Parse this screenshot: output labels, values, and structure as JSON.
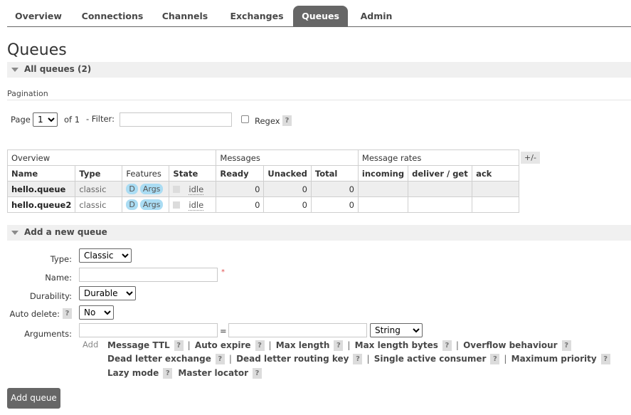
{
  "nav": {
    "tabs": [
      {
        "label": "Overview"
      },
      {
        "label": "Connections"
      },
      {
        "label": "Channels"
      },
      {
        "label": "Exchanges"
      },
      {
        "label": "Queues",
        "active": true
      },
      {
        "label": "Admin"
      }
    ]
  },
  "page": {
    "title": "Queues",
    "all_queues_label": "All queues (2)",
    "pagination_label": "Pagination"
  },
  "pager": {
    "page_label": "Page",
    "page_value": "1",
    "of_label": "of 1",
    "filter_label": "- Filter:",
    "filter_value": "",
    "regex_label": "Regex",
    "help": "?"
  },
  "table": {
    "group_headers": [
      "Overview",
      "Messages",
      "Message rates"
    ],
    "plus_minus": "+/-",
    "columns": [
      "Name",
      "Type",
      "Features",
      "State",
      "Ready",
      "Unacked",
      "Total",
      "incoming",
      "deliver / get",
      "ack"
    ],
    "rows": [
      {
        "name": "hello.queue",
        "type": "classic",
        "feature_d": "D",
        "feature_args": "Args",
        "state": "idle",
        "ready": "0",
        "unacked": "0",
        "total": "0",
        "incoming": "",
        "deliver_get": "",
        "ack": ""
      },
      {
        "name": "hello.queue2",
        "type": "classic",
        "feature_d": "D",
        "feature_args": "Args",
        "state": "idle",
        "ready": "0",
        "unacked": "0",
        "total": "0",
        "incoming": "",
        "deliver_get": "",
        "ack": ""
      }
    ]
  },
  "add_queue": {
    "section_label": "Add a new queue",
    "type_label": "Type:",
    "type_value": "Classic",
    "name_label": "Name:",
    "name_value": "",
    "required_mark": "*",
    "durability_label": "Durability:",
    "durability_value": "Durable",
    "auto_delete_label": "Auto delete:",
    "auto_delete_value": "No",
    "arguments_label": "Arguments:",
    "arg_key_value": "",
    "equals": "=",
    "arg_value_value": "",
    "arg_type_value": "String",
    "add_word": "Add",
    "hints_line1": [
      "Message TTL",
      "Auto expire",
      "Max length",
      "Max length bytes",
      "Overflow behaviour"
    ],
    "hints_line2": [
      "Dead letter exchange",
      "Dead letter routing key",
      "Single active consumer",
      "Maximum priority"
    ],
    "hints_line3": [
      "Lazy mode",
      "Master locator"
    ],
    "help": "?",
    "separator": "|",
    "submit_label": "Add queue"
  }
}
